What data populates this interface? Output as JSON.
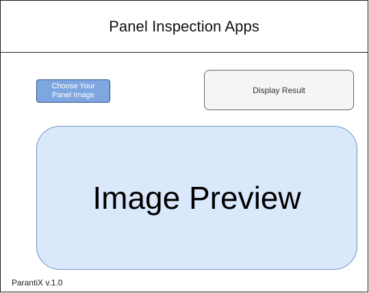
{
  "app": {
    "title": "Panel Inspection Apps"
  },
  "buttons": {
    "choose_image_label": "Choose Your\nPanel Image",
    "display_result_label": "Display Result"
  },
  "preview": {
    "label": "Image Preview"
  },
  "footer": {
    "version": "ParantiX v.1.0"
  },
  "colors": {
    "choose_button_fill": "#7ea6e0",
    "choose_button_border": "#2b4f86",
    "display_button_fill": "#f5f5f5",
    "preview_fill": "#dae8fc",
    "preview_border": "#6c8ebf"
  }
}
